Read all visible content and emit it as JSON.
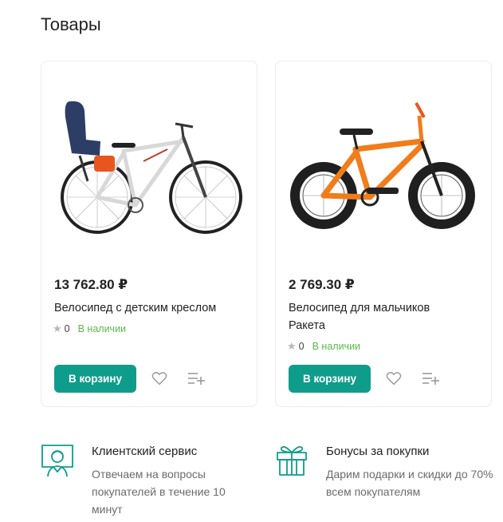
{
  "section": {
    "title": "Товары"
  },
  "products": [
    {
      "price": "13 762.80 ₽",
      "name": "Велосипед с детским креслом",
      "rating": "0",
      "stock": "В наличии",
      "cart_label": "В корзину",
      "image": "bicycle-with-child-seat"
    },
    {
      "price": "2 769.30 ₽",
      "name": "Велосипед для мальчиков Ракета",
      "rating": "0",
      "stock": "В наличии",
      "cart_label": "В корзину",
      "image": "orange-kids-bicycle"
    }
  ],
  "features": [
    {
      "icon": "customer-service-icon",
      "title": "Клиентский сервис",
      "text": "Отвечаем на вопросы покупателей в течение 10 минут"
    },
    {
      "icon": "gift-icon",
      "title": "Бонусы за покупки",
      "text": "Дарим подарки и скидки до 70% всем покупателям"
    }
  ],
  "colors": {
    "accent": "#0f9d8b",
    "in_stock": "#5ab84b",
    "star": "#b7b7b7"
  }
}
